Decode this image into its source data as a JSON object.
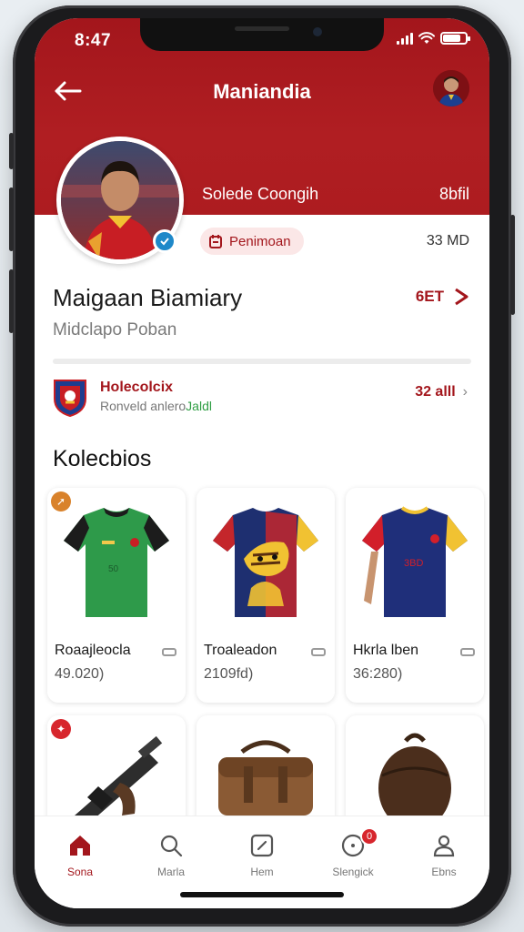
{
  "status_bar": {
    "time": "8:47",
    "battery_level": 0.8
  },
  "header": {
    "title": "Maniandia",
    "back_icon": "arrow-left-icon",
    "avatar_icon": "user-avatar"
  },
  "profile": {
    "club_text": "Solede Coongih",
    "stat_right": "8bfil",
    "badge_label": "Penimoan",
    "count_right": "33 MD",
    "name": "Maigaan Biamiary",
    "position": "Midclapo Poban",
    "follow_label": "6ET"
  },
  "club": {
    "title": "Holecolcix",
    "sub_plain": "Ronveld anlero",
    "sub_green": "Jaldl",
    "right_value": "32 alll"
  },
  "collections": {
    "title": "Kolecbios",
    "items": [
      {
        "name": "Roaajleocla",
        "price": "49.020)",
        "kind": "green-jersey"
      },
      {
        "name": "Troaleadon",
        "price": "2109fd)",
        "kind": "tiger-jersey"
      },
      {
        "name": "Hkrla lben",
        "price": "36:280)",
        "kind": "navy-jersey"
      },
      {
        "name": "",
        "price": "",
        "kind": "rifle"
      },
      {
        "name": "",
        "price": "",
        "kind": "satchel"
      },
      {
        "name": "",
        "price": "",
        "kind": "leather-pouch"
      }
    ]
  },
  "tabs": [
    {
      "label": "Sona",
      "icon": "home-icon",
      "active": true
    },
    {
      "label": "Marla",
      "icon": "search-icon",
      "active": false
    },
    {
      "label": "Hem",
      "icon": "edit-box-icon",
      "active": false
    },
    {
      "label": "Slengick",
      "icon": "chat-icon",
      "active": false,
      "badge": "0"
    },
    {
      "label": "Ebns",
      "icon": "profile-icon",
      "active": false
    }
  ],
  "colors": {
    "brand": "#a3161c",
    "accent_green": "#2f9e44"
  }
}
